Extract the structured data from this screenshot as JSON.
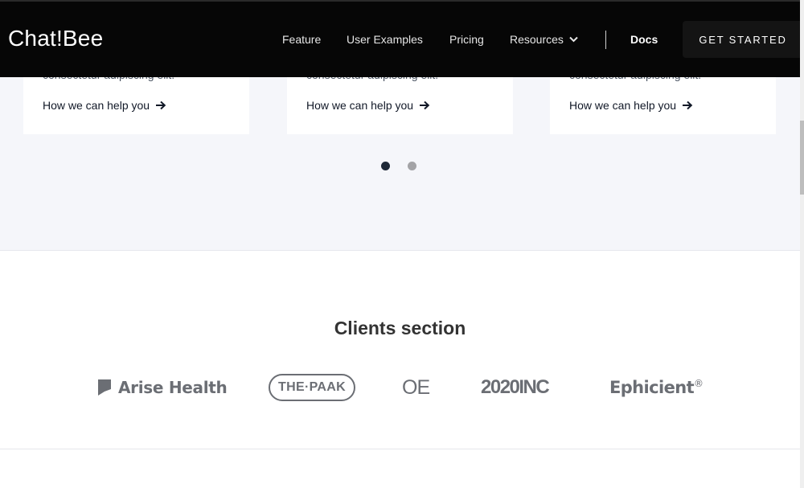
{
  "header": {
    "logo": "Chat!Bee",
    "nav": {
      "feature": "Feature",
      "user_examples": "User Examples",
      "pricing": "Pricing",
      "resources": "Resources",
      "docs": "Docs"
    },
    "cta_label": "GET STARTED"
  },
  "feature_cards": [
    {
      "text": "consectetur adipiscing elit.",
      "link_label": "How we can help you"
    },
    {
      "text": "consectetur adipiscing elit.",
      "link_label": "How we can help you"
    },
    {
      "text": "consectetur adipiscing elit.",
      "link_label": "How we can help you"
    }
  ],
  "carousel": {
    "active_slide": 1,
    "slide_count": 2
  },
  "clients": {
    "title": "Clients section",
    "logos": [
      {
        "name": "Arise Health",
        "icon": "flag-icon"
      },
      {
        "name": "THE·PAAK"
      },
      {
        "name": "OE"
      },
      {
        "name": "2020INC"
      },
      {
        "name": "Ephicient",
        "mark": "®"
      }
    ]
  },
  "colors": {
    "header_bg": "#060606",
    "band_bg": "#f5f6fa",
    "logo_gray": "#6b6e74",
    "text_dark": "#1f2937"
  }
}
